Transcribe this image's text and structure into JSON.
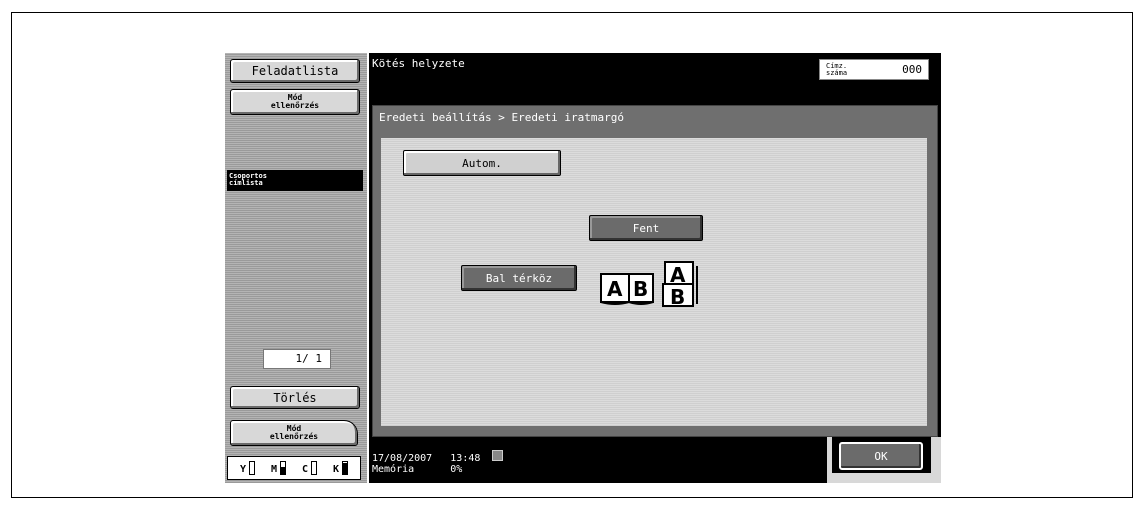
{
  "sidebar": {
    "job_list_label": "Feladatlista",
    "mode_check_label": "Mód\nellenőrzés",
    "group_list_label": "Csoportos\ncímlista",
    "page_indicator": "1/  1",
    "delete_label": "Törlés",
    "mode_check_bottom_label": "Mód\nellenőrzés",
    "toner": [
      {
        "label": "Y",
        "level": 0.0
      },
      {
        "label": "M",
        "level": 0.6
      },
      {
        "label": "C",
        "level": 0.0
      },
      {
        "label": "K",
        "level": 0.9
      }
    ]
  },
  "header": {
    "title": "Kötés helyzete",
    "counter_label": "Címz.\nszáma",
    "counter_value": "000"
  },
  "panel": {
    "breadcrumb": "Eredeti beállítás > Eredeti iratmargó",
    "options": {
      "auto_label": "Autom.",
      "top_label": "Fent",
      "left_label": "Bal térköz"
    }
  },
  "footer": {
    "date": "17/08/2007",
    "time": "13:48",
    "memory_label": "Memória",
    "memory_value": "0%",
    "ok_label": "OK"
  },
  "icons": {
    "status": "network-icon",
    "binding_preview": "book-pages-icon"
  }
}
